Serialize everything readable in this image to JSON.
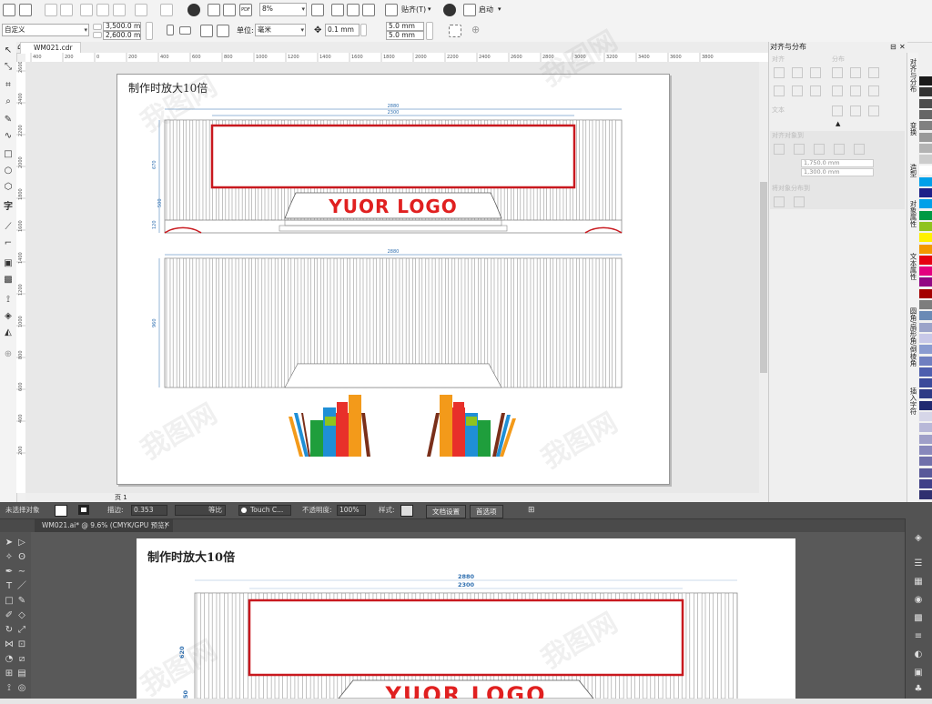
{
  "corel": {
    "toolbar1": {
      "zoom": "8%",
      "snap_label": "贴齐(T)",
      "launch_label": "启动"
    },
    "toolbar2": {
      "preset": "自定义",
      "width": "3,500.0 mm",
      "height": "2,600.0 mm",
      "unit_label": "单位:",
      "unit_value": "毫米",
      "nudge": "0.1 mm",
      "dup_x": "5.0 mm",
      "dup_y": "5.0 mm"
    },
    "doc_tab": "WM021.cdr",
    "ruler_labels": [
      "400",
      "200",
      "0",
      "200",
      "400",
      "600",
      "800",
      "1000",
      "1200",
      "1400",
      "1600",
      "1800",
      "2000",
      "2200",
      "2400",
      "2600",
      "2800",
      "3000",
      "3200",
      "3400",
      "3600",
      "3800"
    ],
    "vruler_labels": [
      "2600",
      "2400",
      "2200",
      "2000",
      "1800",
      "1600",
      "1400",
      "1200",
      "1000",
      "800",
      "600",
      "400",
      "200"
    ],
    "page_note": "制作时放大10倍",
    "drawing": {
      "dim_top_outer": "2880",
      "dim_top_inner": "2300",
      "dim_mid": "2880",
      "dim_left_1": "670",
      "dim_left_2": "500",
      "dim_left_3": "120",
      "dim_left_lower": "960",
      "logo_text": "YUOR LOGO"
    },
    "pager": {
      "label": "页 1",
      "current": "1"
    },
    "dock": {
      "title": "对齐与分布",
      "align": "对齐",
      "distribute": "分布",
      "text": "文本",
      "align_to": "对齐对象到",
      "x_value": "1,750.0 mm",
      "y_value": "1,300.0 mm",
      "distribute_to": "将对象分布到"
    },
    "side_tabs": [
      "对齐与分布",
      "变换",
      "造型",
      "对象属性",
      "文本属性",
      "圆角/扇形角/倒棱角",
      "插入字符"
    ],
    "palette": [
      "#1a1a1a",
      "#333333",
      "#4d4d4d",
      "#666666",
      "#808080",
      "#999999",
      "#b3b3b3",
      "#cccccc",
      "#ffffff",
      "#00a0e9",
      "#1d2088",
      "#00a0e9",
      "#009944",
      "#8fc31f",
      "#fff100",
      "#f39800",
      "#e60012",
      "#e4007f",
      "#920783",
      "#a40000",
      "#7d7d7d",
      "#6a8ab5",
      "#9ba3c9",
      "#c8c8e8",
      "#8a9bd0",
      "#6f7fc0",
      "#4e5fae",
      "#3b4a9a",
      "#2e3a85",
      "#202a70",
      "#d6d6e8",
      "#b8b8d8",
      "#9f9fc8",
      "#8888bb",
      "#7070aa",
      "#585899",
      "#404088",
      "#303070"
    ]
  },
  "ai": {
    "selection": "未选择对象",
    "stroke_label": "描边:",
    "stroke_value": "0.353",
    "stroke_style": "等比",
    "brush": "Touch C...",
    "opacity_label": "不透明度:",
    "opacity_value": "100%",
    "style_label": "样式:",
    "doc_setup": "文档设置",
    "preferences": "首选项",
    "doc_tab": "WM021.ai* @ 9.6% (CMYK/GPU 预览)",
    "page_note": "制作时放大10倍",
    "dim_outer": "2880",
    "dim_inner": "2300",
    "dim_left": "620",
    "dim_left2": "50",
    "logo_text": "YUOR LOGO"
  },
  "colors": {
    "logo_red": "#e02020",
    "frame_red": "#c8181e",
    "dim_blue": "#2f6fb0",
    "book_colors": [
      "#e8302a",
      "#1f9e3c",
      "#1f8fd6",
      "#f39a1a",
      "#7a2f1a",
      "#e8302a"
    ]
  }
}
